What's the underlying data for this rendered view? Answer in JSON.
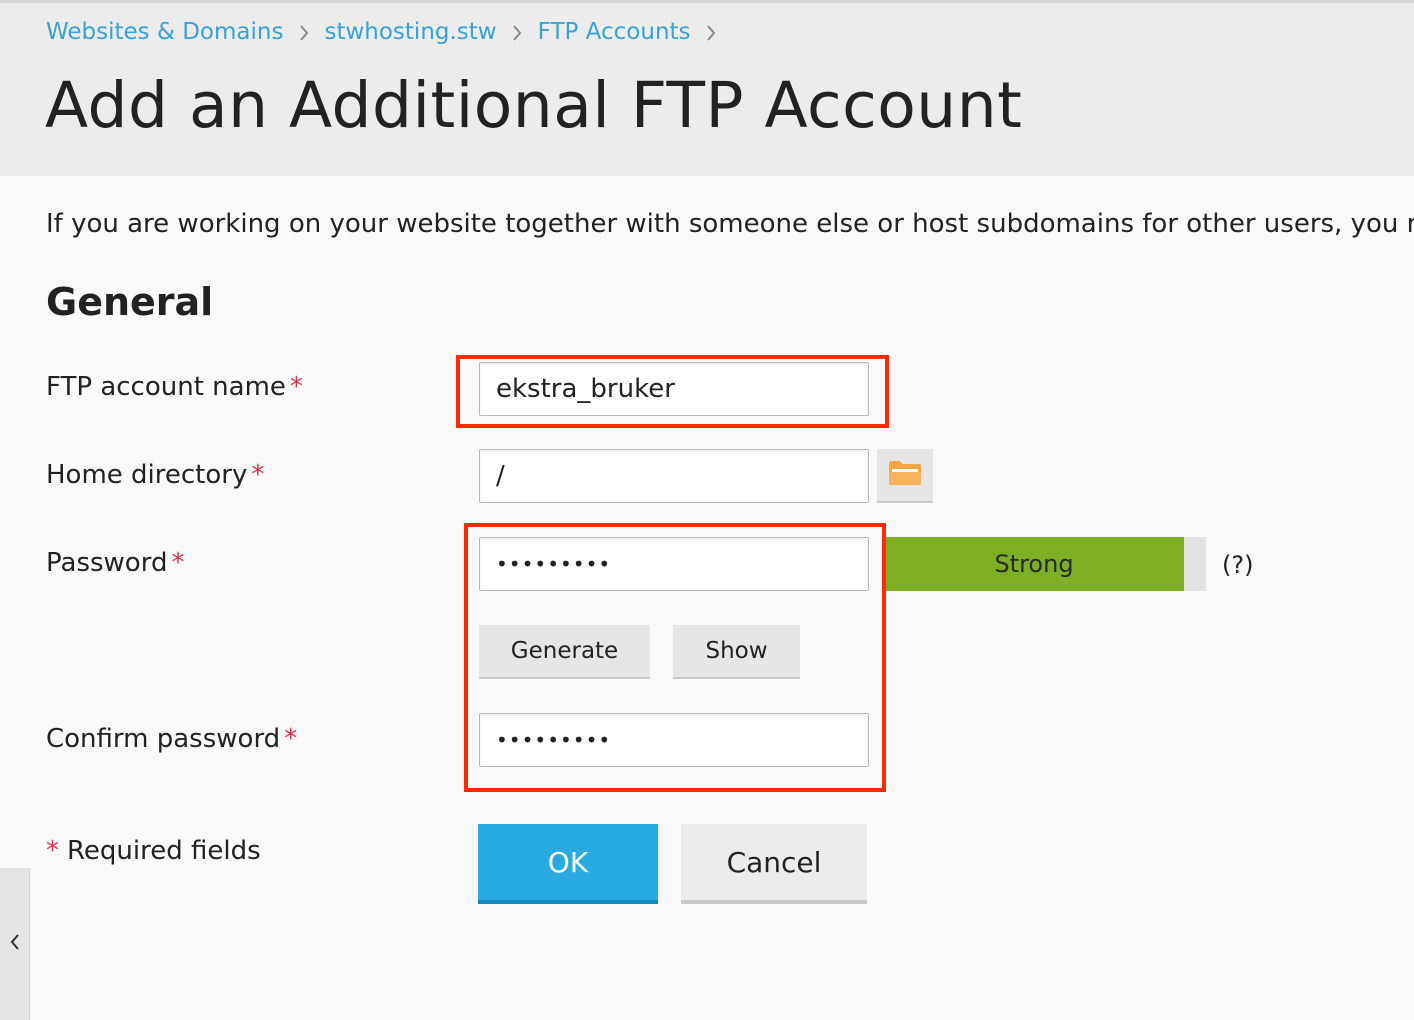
{
  "breadcrumb": [
    {
      "label": "Websites & Domains"
    },
    {
      "label": "stwhosting.stw"
    },
    {
      "label": "FTP Accounts"
    }
  ],
  "page_title": "Add an Additional FTP Account",
  "intro_text": "If you are working on your website together with someone else or host subdomains for other users, you m",
  "section_title": "General",
  "form": {
    "required_marker": "*",
    "ftp_account_name": {
      "label": "FTP account name",
      "value": "ekstra_bruker"
    },
    "home_directory": {
      "label": "Home directory",
      "value": "/",
      "browse_icon": "folder-icon"
    },
    "password": {
      "label": "Password",
      "value": "•••••••••",
      "strength_label": "Strong",
      "strength_level": 0.93,
      "help": "(?)"
    },
    "generate_label": "Generate",
    "show_label": "Show",
    "confirm_password": {
      "label": "Confirm password",
      "value": "•••••••••"
    },
    "required_note": "Required fields"
  },
  "actions": {
    "ok_label": "OK",
    "cancel_label": "Cancel"
  },
  "colors": {
    "link": "#3aa1d4",
    "required": "#d9334a",
    "strength_strong": "#7eae25",
    "primary_button": "#28aae1",
    "highlight": "#ff2a00",
    "folder_icon": "#f5a547"
  },
  "icons": {
    "breadcrumb_separator": "chevron-right-icon",
    "sidebar_toggle": "chevron-left-icon"
  }
}
